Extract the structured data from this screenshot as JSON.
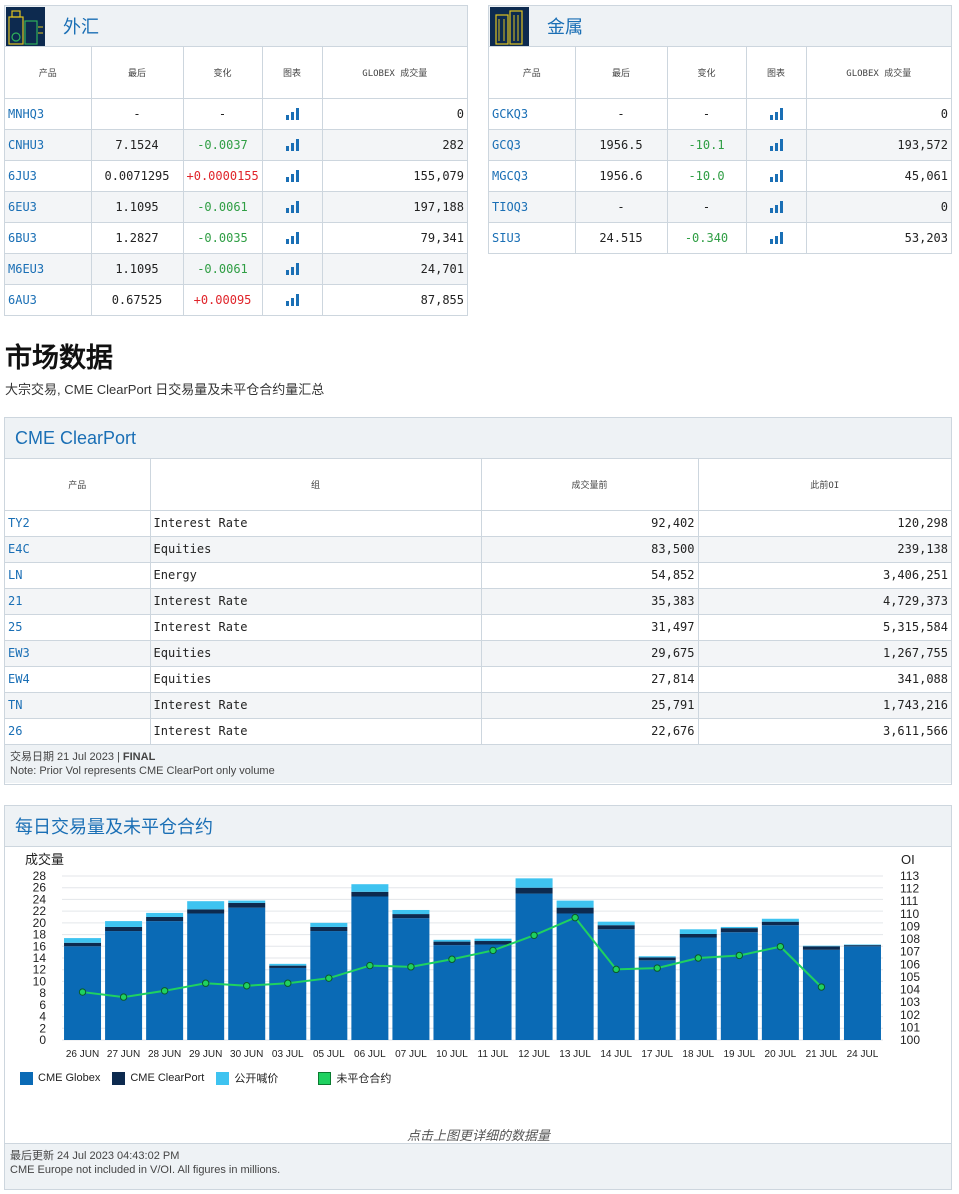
{
  "fx": {
    "title": "外汇",
    "headers": [
      "产品",
      "最后",
      "变化",
      "图表",
      "GLOBEX 成交量"
    ],
    "rows": [
      {
        "product": "MNHQ3",
        "last": "-",
        "change": "-",
        "chg_dir": "none",
        "volume": "0"
      },
      {
        "product": "CNHU3",
        "last": "7.1524",
        "change": "-0.0037",
        "chg_dir": "neg",
        "volume": "282"
      },
      {
        "product": "6JU3",
        "last": "0.0071295",
        "change": "+0.0000155",
        "chg_dir": "pos",
        "volume": "155,079"
      },
      {
        "product": "6EU3",
        "last": "1.1095",
        "change": "-0.0061",
        "chg_dir": "neg",
        "volume": "197,188"
      },
      {
        "product": "6BU3",
        "last": "1.2827",
        "change": "-0.0035",
        "chg_dir": "neg",
        "volume": "79,341"
      },
      {
        "product": "M6EU3",
        "last": "1.1095",
        "change": "-0.0061",
        "chg_dir": "neg",
        "volume": "24,701"
      },
      {
        "product": "6AU3",
        "last": "0.67525",
        "change": "+0.00095",
        "chg_dir": "pos",
        "volume": "87,855"
      }
    ]
  },
  "metals": {
    "title": "金属",
    "headers": [
      "产品",
      "最后",
      "变化",
      "图表",
      "GLOBEX 成交量"
    ],
    "rows": [
      {
        "product": "GCKQ3",
        "last": "-",
        "change": "-",
        "chg_dir": "none",
        "volume": "0"
      },
      {
        "product": "GCQ3",
        "last": "1956.5",
        "change": "-10.1",
        "chg_dir": "neg",
        "volume": "193,572"
      },
      {
        "product": "MGCQ3",
        "last": "1956.6",
        "change": "-10.0",
        "chg_dir": "neg",
        "volume": "45,061"
      },
      {
        "product": "TIOQ3",
        "last": "-",
        "change": "-",
        "chg_dir": "none",
        "volume": "0"
      },
      {
        "product": "SIU3",
        "last": "24.515",
        "change": "-0.340",
        "chg_dir": "neg",
        "volume": "53,203"
      }
    ]
  },
  "market": {
    "title": "市场数据",
    "subtitle": "大宗交易, CME ClearPort 日交易量及未平仓合约量汇总"
  },
  "clearport": {
    "title": "CME ClearPort",
    "headers": [
      "产品",
      "组",
      "成交量前",
      "此前OI"
    ],
    "rows": [
      {
        "product": "TY2",
        "group": "Interest Rate",
        "prior_vol": "92,402",
        "prior_oi": "120,298"
      },
      {
        "product": "E4C",
        "group": "Equities",
        "prior_vol": "83,500",
        "prior_oi": "239,138"
      },
      {
        "product": "LN",
        "group": "Energy",
        "prior_vol": "54,852",
        "prior_oi": "3,406,251"
      },
      {
        "product": "21",
        "group": "Interest Rate",
        "prior_vol": "35,383",
        "prior_oi": "4,729,373"
      },
      {
        "product": "25",
        "group": "Interest Rate",
        "prior_vol": "31,497",
        "prior_oi": "5,315,584"
      },
      {
        "product": "EW3",
        "group": "Equities",
        "prior_vol": "29,675",
        "prior_oi": "1,267,755"
      },
      {
        "product": "EW4",
        "group": "Equities",
        "prior_vol": "27,814",
        "prior_oi": "341,088"
      },
      {
        "product": "TN",
        "group": "Interest Rate",
        "prior_vol": "25,791",
        "prior_oi": "1,743,216"
      },
      {
        "product": "26",
        "group": "Interest Rate",
        "prior_vol": "22,676",
        "prior_oi": "3,611,566"
      }
    ],
    "trade_date_prefix": "交易日期 21 Jul 2023 | ",
    "trade_date_status": "FINAL",
    "note": "Note: Prior Vol represents CME ClearPort only volume"
  },
  "daily": {
    "title": "每日交易量及未平仓合约",
    "hint": "点击上图更详细的数据量",
    "last_updated": "最后更新 24 Jul 2023 04:43:02 PM",
    "footnote": "CME Europe not included in V/OI. All figures in millions."
  },
  "chart_data": {
    "type": "bar",
    "ylabel": "成交量",
    "y2label": "OI",
    "ylim": [
      0,
      28
    ],
    "y2lim": [
      100,
      113
    ],
    "categories": [
      "26 JUN",
      "27 JUN",
      "28 JUN",
      "29 JUN",
      "30 JUN",
      "03 JUL",
      "05 JUL",
      "06 JUL",
      "07 JUL",
      "10 JUL",
      "11 JUL",
      "12 JUL",
      "13 JUL",
      "14 JUL",
      "17 JUL",
      "18 JUL",
      "19 JUL",
      "20 JUL",
      "21 JUL",
      "24 JUL"
    ],
    "series": [
      {
        "name": "CME Globex",
        "color": "#0a6ab5",
        "stack": true,
        "values": [
          16.0,
          18.6,
          20.3,
          21.6,
          22.6,
          12.3,
          18.6,
          24.5,
          20.8,
          16.2,
          16.3,
          25.0,
          21.6,
          18.9,
          13.6,
          17.5,
          18.4,
          19.6,
          15.4,
          16.0
        ]
      },
      {
        "name": "CME ClearPort",
        "color": "#0d2a4f",
        "stack": true,
        "values": [
          0.6,
          0.7,
          0.7,
          0.7,
          0.8,
          0.4,
          0.7,
          0.8,
          0.7,
          0.6,
          0.6,
          1.0,
          1.0,
          0.7,
          0.5,
          0.6,
          0.7,
          0.6,
          0.6,
          0.2
        ]
      },
      {
        "name": "公开喊价",
        "color": "#3ec3f0",
        "stack": true,
        "values": [
          0.8,
          1.0,
          0.7,
          1.4,
          0.4,
          0.3,
          0.7,
          1.3,
          0.7,
          0.3,
          0.4,
          1.6,
          1.2,
          0.6,
          0.2,
          0.8,
          0.2,
          0.5,
          0.1,
          0.1
        ]
      },
      {
        "name": "未平仓合约",
        "color": "#1fd160",
        "axis": "right",
        "type": "line",
        "values": [
          103.8,
          103.4,
          103.9,
          104.5,
          104.3,
          104.5,
          104.9,
          105.9,
          105.8,
          106.4,
          107.1,
          108.3,
          109.7,
          105.6,
          105.7,
          106.5,
          106.7,
          107.4,
          104.2,
          null
        ]
      }
    ]
  }
}
